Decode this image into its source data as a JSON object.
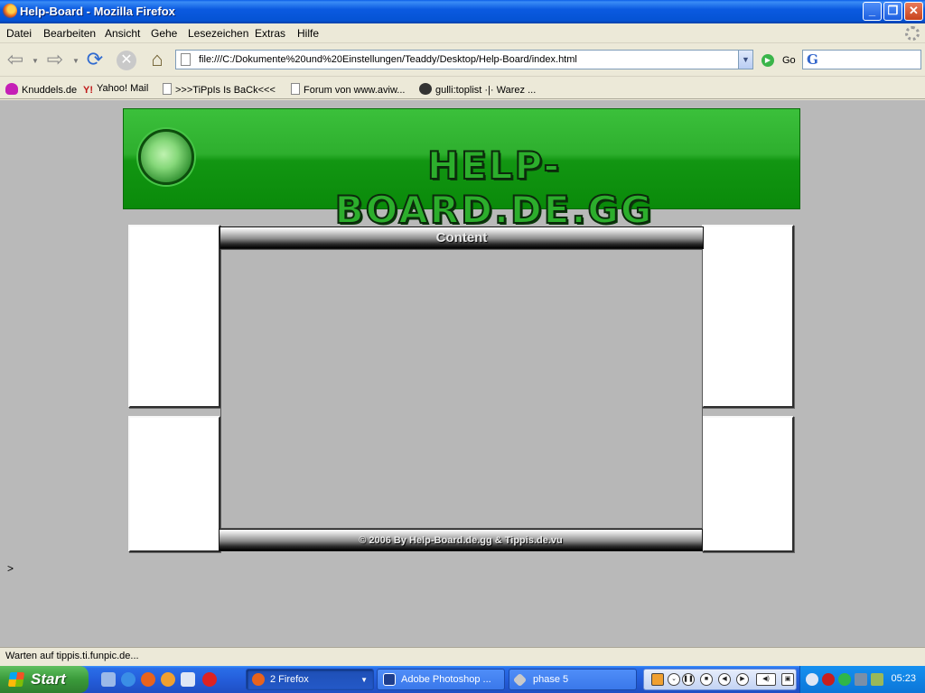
{
  "window": {
    "title": "Help-Board - Mozilla Firefox",
    "buttons": {
      "minimize": "_",
      "maximize": "❐",
      "close": "✕"
    }
  },
  "menu": [
    "Datei",
    "Bearbeiten",
    "Ansicht",
    "Gehe",
    "Lesezeichen",
    "Extras",
    "Hilfe"
  ],
  "nav": {
    "url": "file:///C:/Dokumente%20und%20Einstellungen/Teaddy/Desktop/Help-Board/index.html",
    "go_label": "Go",
    "search_logo": "G"
  },
  "bookmarks": [
    {
      "label": "Knuddels.de",
      "icon": "knuddels-icon"
    },
    {
      "label": "Yahoo! Mail",
      "icon": "yahoo-icon",
      "glyph": "Y!"
    },
    {
      "label": ">>>TiPpIs Is BaCk<<<",
      "icon": "page-icon"
    },
    {
      "label": "Forum von www.aviw...",
      "icon": "page-icon"
    },
    {
      "label": "gulli:toplist ·|· Warez ...",
      "icon": "gulli-icon"
    }
  ],
  "page": {
    "banner_title": "HELP-BOARD.DE.GG",
    "content_header": "Content",
    "footer_text": "© 2006 By Help-Board.de.gg & Tippis.de.vu",
    "stray_text": ">"
  },
  "status": {
    "text": "Warten auf tippis.ti.funpic.de..."
  },
  "taskbar": {
    "start_label": "Start",
    "tasks": [
      {
        "label": "2 Firefox",
        "arrow": "▼"
      },
      {
        "label": "Adobe Photoshop ..."
      },
      {
        "label": "phase 5"
      }
    ],
    "clock": "05:23"
  }
}
